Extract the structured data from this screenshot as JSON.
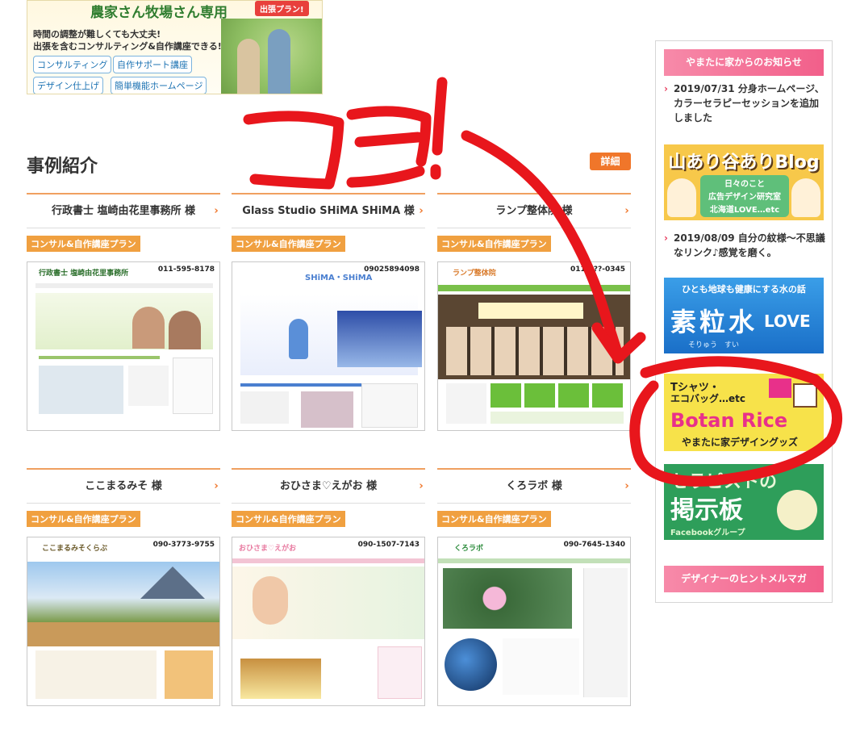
{
  "top_banner": {
    "title": "農家さん牧場さん専用",
    "tag": "出張プラン!",
    "line1": "時間の調整が難しくても大丈夫!",
    "line2": "出張を含むコンサルティング&自作講座できる!",
    "buttons": [
      "コンサルティング",
      "自作サポート講座",
      "デザイン仕上げ",
      "簡単機能ホームページ"
    ]
  },
  "cases": {
    "title": "事例紹介",
    "more_label": "詳細",
    "items": [
      {
        "name": "行政書士 塩崎由花里事務所 様",
        "tag": "コンサル&自作講座プラン",
        "shot_title": "行政書士 塩崎由花里事務所",
        "shot_phone": "011-595-8178",
        "accent": "#6bbf3a"
      },
      {
        "name": "Glass Studio SHiMA SHiMA 様",
        "tag": "コンサル&自作講座プラン",
        "shot_title": "SHiMA・SHiMA",
        "shot_phone": "09025894098",
        "accent": "#4a7fd0"
      },
      {
        "name": "ランプ整体院 様",
        "tag": "コンサル&自作講座プラン",
        "shot_title": "ランプ整体院",
        "shot_phone": "011-2??-0345",
        "accent": "#6bbf3a"
      },
      {
        "name": "ここまるみそ 様",
        "tag": "コンサル&自作講座プラン",
        "shot_title": "ここまるみそくらぶ",
        "shot_phone": "090-3773-9755",
        "accent": "#a08030"
      },
      {
        "name": "おひさま♡えがお 様",
        "tag": "コンサル&自作講座プラン",
        "shot_title": "おひさま♡えがお",
        "shot_phone": "090-1507-7143",
        "accent": "#f08db0"
      },
      {
        "name": "くろラボ 様",
        "tag": "コンサル&自作講座プラン",
        "shot_title": "くろラボ",
        "shot_phone": "090-7645-1340",
        "accent": "#3aa04a"
      }
    ]
  },
  "sidebar": {
    "news_heading": "やまたに家からのお知らせ",
    "news": [
      "2019/07/31 分身ホームページ、カラーセラピーセッションを追加しました",
      "2019/08/09 自分の紋様〜不思議なリンク♪感覚を磨く。"
    ],
    "blog_banner": {
      "title": "山あり谷ありBlog",
      "lines": [
        "日々のこと",
        "広告デザイン研究室",
        "北海道LOVE…etc"
      ]
    },
    "water_banner": {
      "top": "ひとも地球も健康にする水の話",
      "title": "素粒水",
      "love": "LOVE",
      "reading": "そりゅう　すい"
    },
    "botan_banner": {
      "top": "Tシャツ・",
      "top2": "エコバッグ…etc",
      "title": "Botan Rice",
      "sub": "やまたに家デザイングッズ"
    },
    "therapist_banner": {
      "title1": "セラピストの",
      "title2": "掲示板",
      "sub": "Facebookグループ"
    },
    "mailmag_heading": "デザイナーのヒントメルマガ"
  },
  "annotation": {
    "text": "ココ!",
    "color": "#e8161c"
  }
}
